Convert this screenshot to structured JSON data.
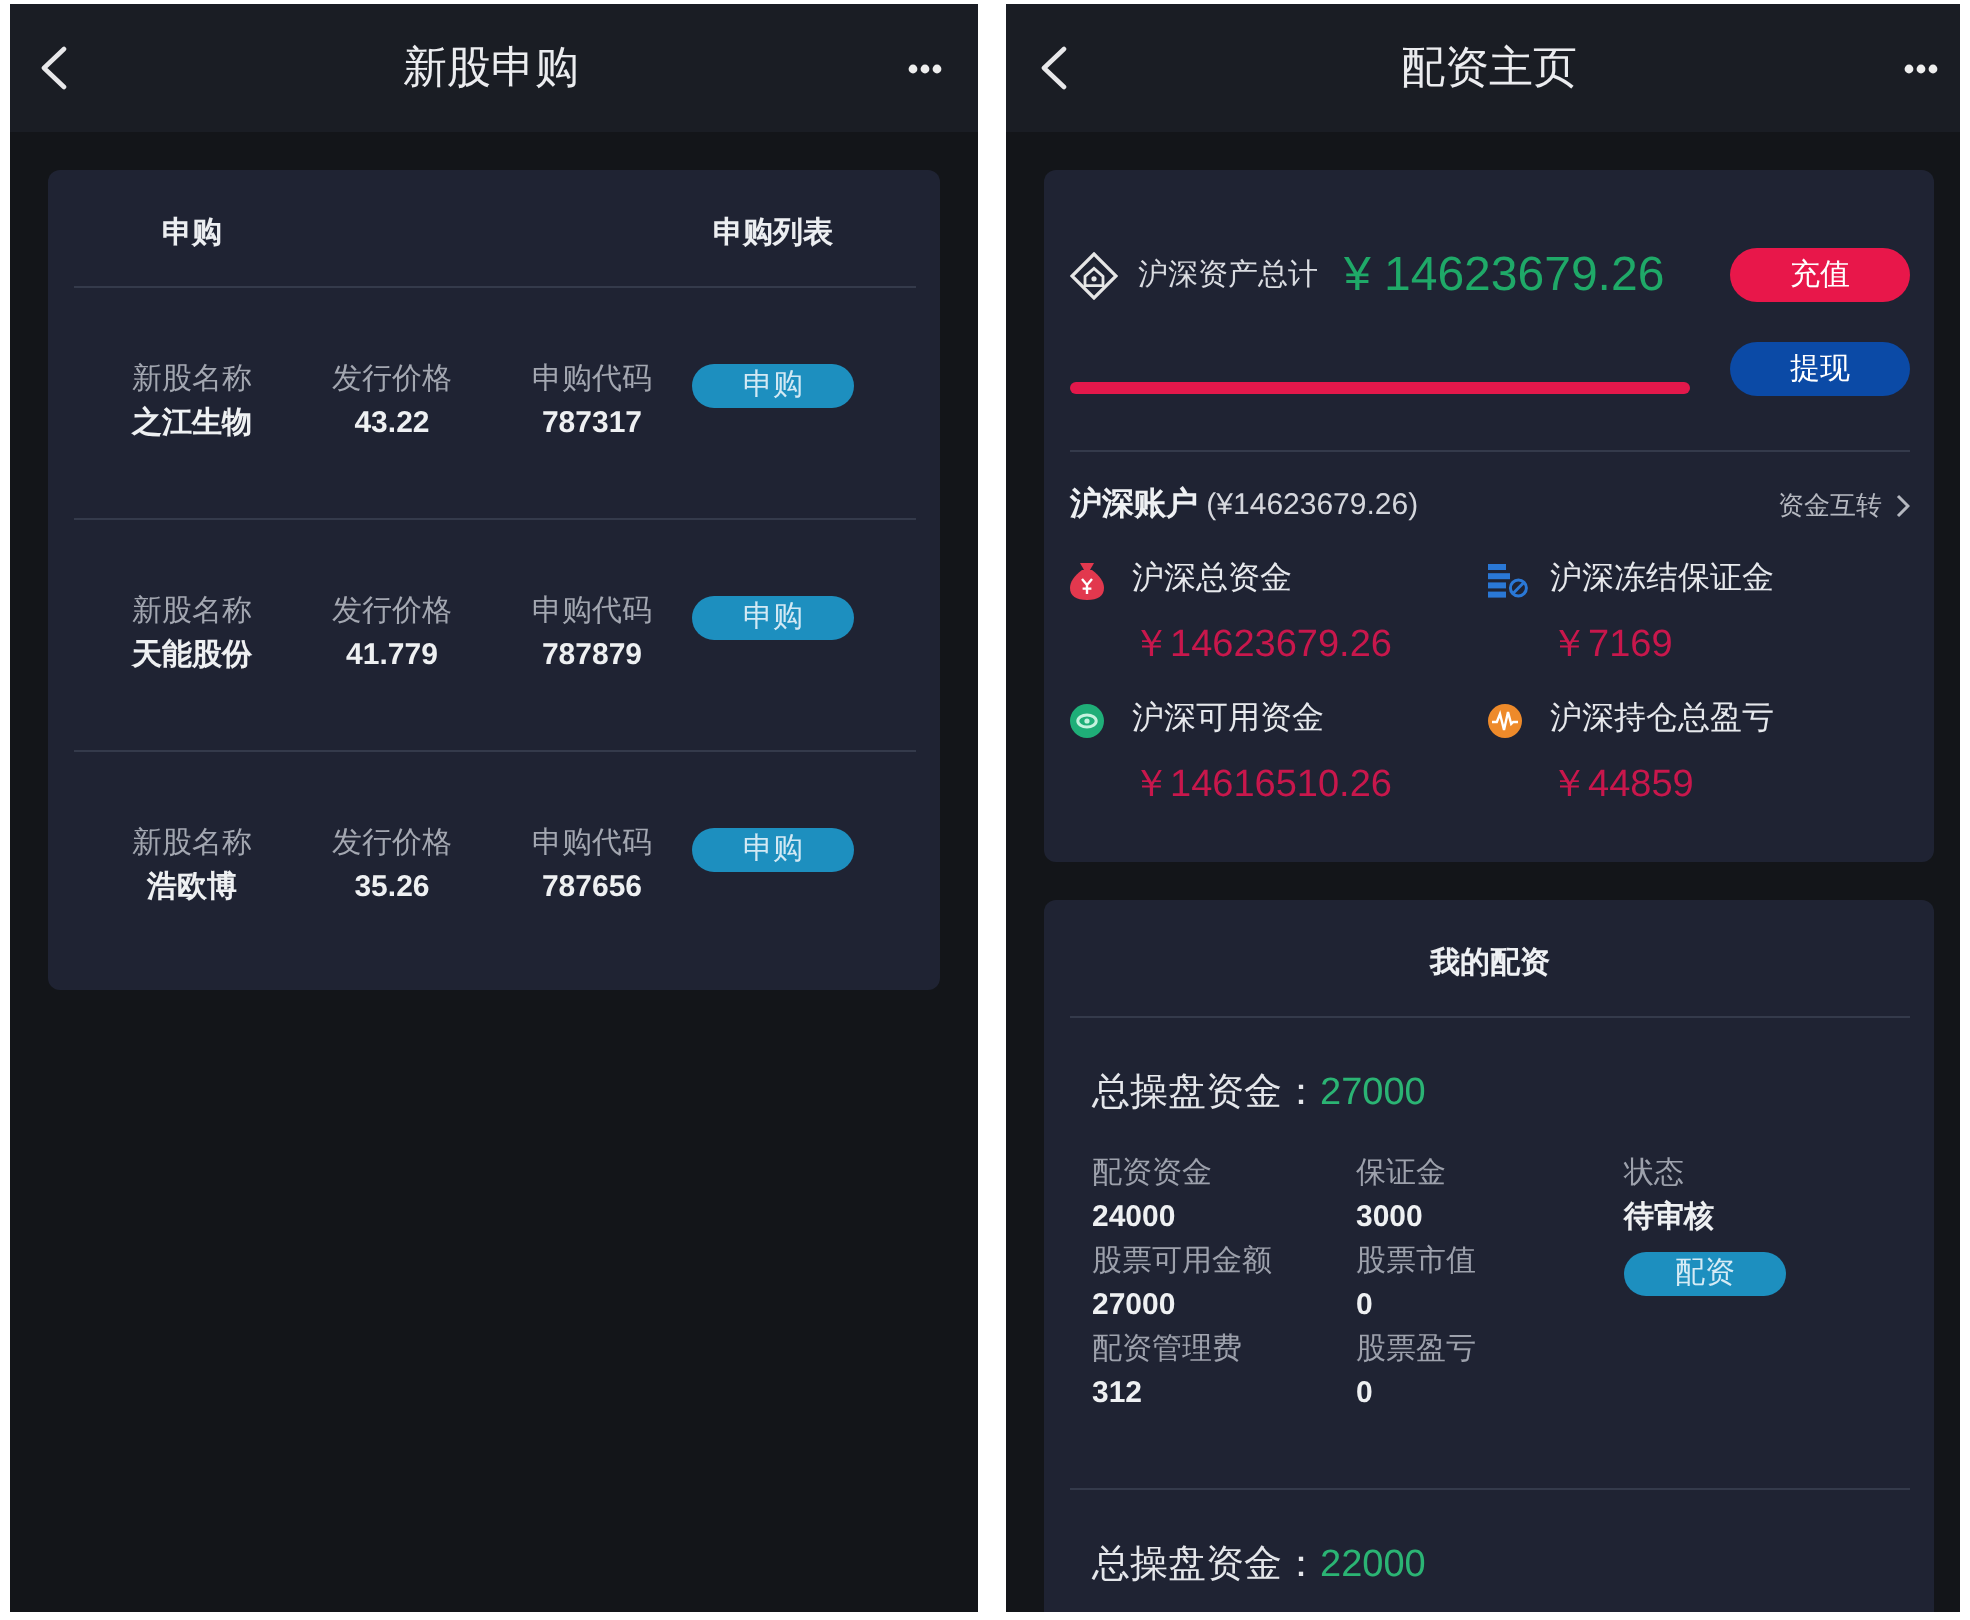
{
  "ipo_screen": {
    "title": "新股申购",
    "subscription_card": {
      "heading": "申购",
      "list_title": "申购列表",
      "stocks": [
        {
          "name_label": "新股名称",
          "name": "之江生物",
          "price_label": "发行价格",
          "price": "43.22",
          "code_label": "申购代码",
          "code": "787317",
          "button": "申购"
        },
        {
          "name_label": "新股名称",
          "name": "天能股份",
          "price_label": "发行价格",
          "price": "41.779",
          "code_label": "申购代码",
          "code": "787879",
          "button": "申购"
        },
        {
          "name_label": "新股名称",
          "name": "浩欧博",
          "price_label": "发行价格",
          "price": "35.26",
          "code_label": "申购代码",
          "code": "787656",
          "button": "申购"
        }
      ]
    }
  },
  "margin_screen": {
    "title": "配资主页",
    "assets_card": {
      "total_label": "沪深资产总计",
      "total": "¥ 14623679.26",
      "recharge_button": "充值",
      "withdraw_button": "提现",
      "account": "**沪深账户** (¥14623679.26)",
      "transfer_link": "资金互转",
      "metrics": [
        {
          "kind": "bag",
          "label": "沪深总资金",
          "value": "￥14623679.26"
        },
        {
          "kind": "ledger",
          "label": "沪深冻结保证金",
          "value": "￥7169"
        },
        {
          "kind": "coin",
          "label": "沪深可用资金",
          "value": "￥14616510.26"
        },
        {
          "kind": "wave",
          "label": "沪深持仓总盈亏",
          "value": "￥44859"
        }
      ]
    },
    "financing_card": {
      "title": "我的配资",
      "plans": [
        {
          "total_label": "总操盘资金：",
          "total": "27000",
          "fields": [
            {
              "label": "配资资金",
              "value": "24000"
            },
            {
              "label": "保证金",
              "value": "3000"
            },
            {
              "label": "股票可用金额",
              "value": "27000"
            },
            {
              "label": "股票市值",
              "value": "0"
            },
            {
              "label": "配资管理费",
              "value": "312"
            },
            {
              "label": "股票盈亏",
              "value": "0"
            }
          ],
          "status_label": "状态",
          "status": "待审核",
          "button": "配资"
        },
        {
          "total_label": "总操盘资金：",
          "total": "22000"
        }
      ]
    }
  }
}
